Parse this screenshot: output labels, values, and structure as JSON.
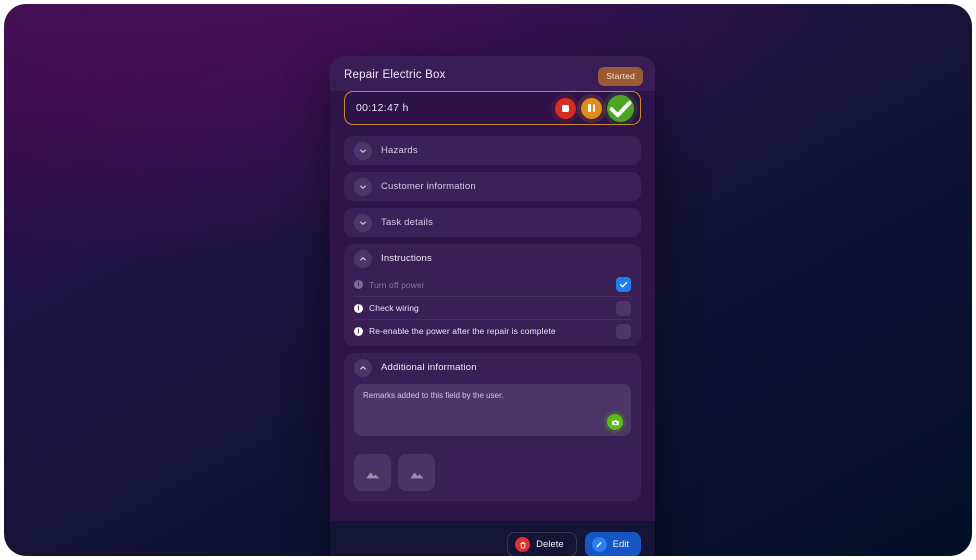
{
  "card": {
    "title": "Repair Electric Box",
    "status_badge": "Started"
  },
  "timer": {
    "value": "00:12:47 h",
    "stop_label": "stop-icon",
    "pause_label": "pause-icon",
    "finish_label": "check-icon",
    "border_color": "#d08a2e"
  },
  "sections": [
    {
      "label": "Hazards",
      "expanded": false,
      "chevron": "chevron-down-icon"
    },
    {
      "label": "Customer information",
      "expanded": false,
      "chevron": "chevron-down-icon"
    },
    {
      "label": "Task details",
      "expanded": false,
      "chevron": "chevron-down-icon"
    },
    {
      "label": "Instructions",
      "expanded": true,
      "chevron": "chevron-up-icon"
    },
    {
      "label": "Additional information",
      "expanded": true,
      "chevron": "chevron-up-icon"
    }
  ],
  "instructions": [
    {
      "text": "Turn off power",
      "checked": true
    },
    {
      "text": "Check wiring",
      "checked": false
    },
    {
      "text": "Re-enable the power after the repair is complete",
      "checked": false
    }
  ],
  "additional_information": {
    "remarks": "Remarks added to this field by the user.",
    "camera_button": "camera-icon",
    "attachments": [
      {
        "icon": "image-icon"
      },
      {
        "icon": "image-icon"
      }
    ]
  },
  "footer": {
    "delete_label": "Delete",
    "edit_label": "Edit"
  },
  "colors": {
    "accent_blue": "#1d7ef0",
    "accent_green": "#4ea524",
    "accent_orange": "#e08b1a",
    "accent_red": "#d92d20",
    "badge": "#9a5b34"
  }
}
